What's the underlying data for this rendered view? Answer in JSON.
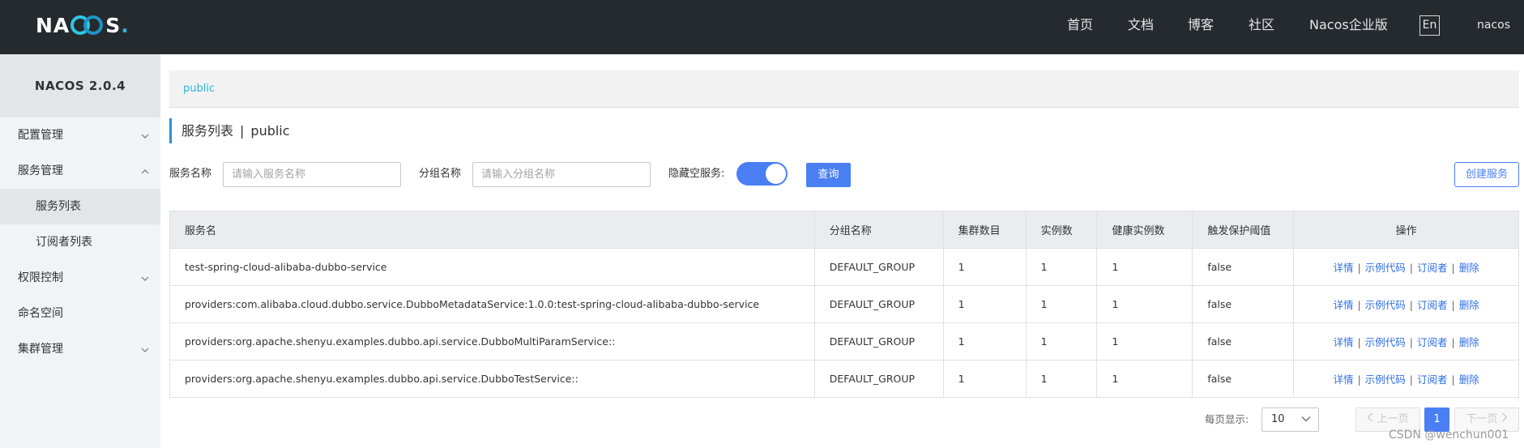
{
  "header": {
    "logo_prefix": "NA",
    "logo_suffix": "S",
    "logo_dot": ".",
    "nav": [
      "首页",
      "文档",
      "博客",
      "社区",
      "Nacos企业版"
    ],
    "lang": "En",
    "user": "nacos"
  },
  "sidebar": {
    "version": "NACOS 2.0.4",
    "items": [
      {
        "label": "配置管理",
        "chevron": "down"
      },
      {
        "label": "服务管理",
        "chevron": "up"
      },
      {
        "label": "服务列表"
      },
      {
        "label": "订阅者列表"
      },
      {
        "label": "权限控制",
        "chevron": "down"
      },
      {
        "label": "命名空间"
      },
      {
        "label": "集群管理",
        "chevron": "down"
      }
    ]
  },
  "breadcrumb": "public",
  "title": {
    "main": "服务列表",
    "sep": "|",
    "ns": "public"
  },
  "filters": {
    "service_name_label": "服务名称",
    "service_name_placeholder": "请输入服务名称",
    "group_name_label": "分组名称",
    "group_name_placeholder": "请输入分组名称",
    "hide_empty_label": "隐藏空服务:",
    "hide_empty_on": true,
    "query_button": "查询",
    "create_button": "创建服务"
  },
  "table": {
    "columns": [
      "服务名",
      "分组名称",
      "集群数目",
      "实例数",
      "健康实例数",
      "触发保护阈值",
      "操作"
    ],
    "actions": [
      "详情",
      "示例代码",
      "订阅者",
      "删除"
    ],
    "action_sep": "|",
    "rows": [
      [
        "test-spring-cloud-alibaba-dubbo-service",
        "DEFAULT_GROUP",
        "1",
        "1",
        "1",
        "false"
      ],
      [
        "providers:com.alibaba.cloud.dubbo.service.DubboMetadataService:1.0.0:test-spring-cloud-alibaba-dubbo-service",
        "DEFAULT_GROUP",
        "1",
        "1",
        "1",
        "false"
      ],
      [
        "providers:org.apache.shenyu.examples.dubbo.api.service.DubboMultiParamService::",
        "DEFAULT_GROUP",
        "1",
        "1",
        "1",
        "false"
      ],
      [
        "providers:org.apache.shenyu.examples.dubbo.api.service.DubboTestService::",
        "DEFAULT_GROUP",
        "1",
        "1",
        "1",
        "false"
      ]
    ]
  },
  "pagination": {
    "page_size_label": "每页显示:",
    "page_size": "10",
    "prev": "上一页",
    "page": "1",
    "next": "下一页"
  },
  "watermark": "CSDN @wenchun001",
  "colors": {
    "header_bg": "#252a2f",
    "primary": "#4a7ef3",
    "accent": "#2bb5d8",
    "sidebar_bg": "#f2f3f5"
  }
}
